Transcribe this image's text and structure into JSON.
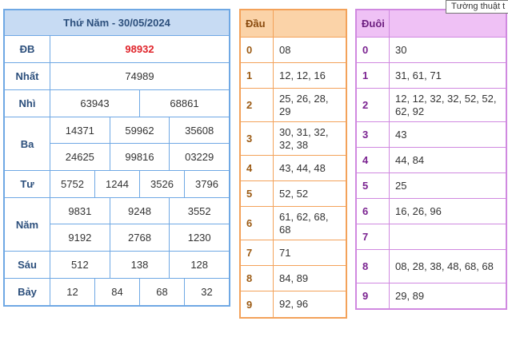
{
  "tooltip": "Tường thuật t",
  "results": {
    "title": "Thứ Năm - 30/05/2024",
    "rows": [
      {
        "label": "ĐB",
        "lines": [
          [
            "98932"
          ]
        ]
      },
      {
        "label": "Nhất",
        "lines": [
          [
            "74989"
          ]
        ]
      },
      {
        "label": "Nhì",
        "lines": [
          [
            "63943",
            "68861"
          ]
        ]
      },
      {
        "label": "Ba",
        "lines": [
          [
            "14371",
            "59962",
            "35608"
          ],
          [
            "24625",
            "99816",
            "03229"
          ]
        ]
      },
      {
        "label": "Tư",
        "lines": [
          [
            "5752",
            "1244",
            "3526",
            "3796"
          ]
        ]
      },
      {
        "label": "Năm",
        "lines": [
          [
            "9831",
            "9248",
            "3552"
          ],
          [
            "9192",
            "2768",
            "1230"
          ]
        ]
      },
      {
        "label": "Sáu",
        "lines": [
          [
            "512",
            "138",
            "128"
          ]
        ]
      },
      {
        "label": "Bảy",
        "lines": [
          [
            "12",
            "84",
            "68",
            "32"
          ]
        ]
      }
    ]
  },
  "dau": {
    "header": "Đầu",
    "rows": [
      {
        "k": "0",
        "v": "08"
      },
      {
        "k": "1",
        "v": "12, 12, 16"
      },
      {
        "k": "2",
        "v": "25, 26, 28, 29"
      },
      {
        "k": "3",
        "v": "30, 31, 32, 32, 38"
      },
      {
        "k": "4",
        "v": "43, 44, 48"
      },
      {
        "k": "5",
        "v": "52, 52"
      },
      {
        "k": "6",
        "v": "61, 62, 68, 68"
      },
      {
        "k": "7",
        "v": "71"
      },
      {
        "k": "8",
        "v": "84, 89"
      },
      {
        "k": "9",
        "v": "92, 96"
      }
    ]
  },
  "duoi": {
    "header": "Đuôi",
    "rows": [
      {
        "k": "0",
        "v": "30"
      },
      {
        "k": "1",
        "v": "31, 61, 71"
      },
      {
        "k": "2",
        "v": "12, 12, 32, 32, 52, 52, 62, 92"
      },
      {
        "k": "3",
        "v": "43"
      },
      {
        "k": "4",
        "v": "44, 84"
      },
      {
        "k": "5",
        "v": "25"
      },
      {
        "k": "6",
        "v": "16, 26, 96"
      },
      {
        "k": "7",
        "v": ""
      },
      {
        "k": "8",
        "v": "08, 28, 38, 48, 68, 68"
      },
      {
        "k": "9",
        "v": "29, 89"
      }
    ]
  },
  "colors": {
    "results_border": "#6fa8e4",
    "results_header_bg": "#c7dbf3",
    "special_prize": "#e0242b",
    "dau_border": "#f3a25a",
    "dau_header_bg": "#fbd3a8",
    "duoi_border": "#d089e0",
    "duoi_header_bg": "#efc1f5"
  }
}
